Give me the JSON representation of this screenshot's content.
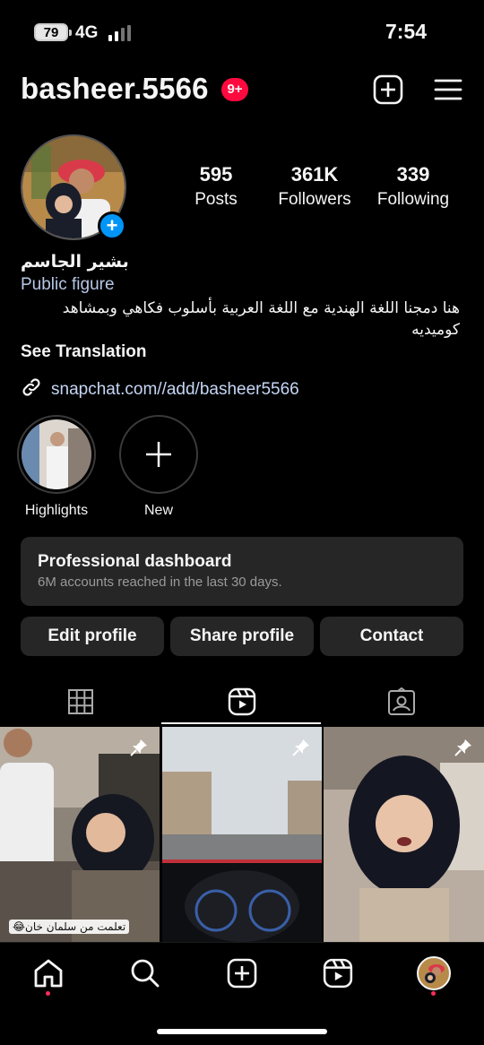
{
  "status_bar": {
    "battery": "79",
    "network": "4G",
    "time": "7:54"
  },
  "header": {
    "username": "basheer.5566",
    "notification_badge": "9+",
    "icons": [
      "add-content-icon",
      "menu-icon"
    ]
  },
  "profile": {
    "stats": [
      {
        "value": "595",
        "label": "Posts"
      },
      {
        "value": "361K",
        "label": "Followers"
      },
      {
        "value": "339",
        "label": "Following"
      }
    ],
    "full_name": "بشير الجاسم",
    "category": "Public figure",
    "bio": "هنا دمجنا اللغة الهندية مع اللغة العربية بأسلوب فكاهي وبمشاهد كوميديه",
    "see_translation": "See Translation",
    "link": "snapchat.com//add/basheer5566"
  },
  "highlights": [
    {
      "label": "Highlights"
    },
    {
      "label": "New"
    }
  ],
  "dashboard": {
    "title": "Professional dashboard",
    "subtitle": "6M accounts reached in the last 30 days."
  },
  "buttons": {
    "edit": "Edit profile",
    "share": "Share profile",
    "contact": "Contact"
  },
  "tabs": [
    "grid-icon",
    "reels-icon",
    "tagged-icon"
  ],
  "grid": {
    "caption_first": "تعلمت من سلمان خان😂"
  },
  "nav": [
    "home-icon",
    "search-icon",
    "create-icon",
    "reels-icon",
    "profile-avatar"
  ],
  "colors": {
    "accent_blue": "#0095f6",
    "badge_red": "#ff0a3f",
    "surface": "#262626"
  }
}
